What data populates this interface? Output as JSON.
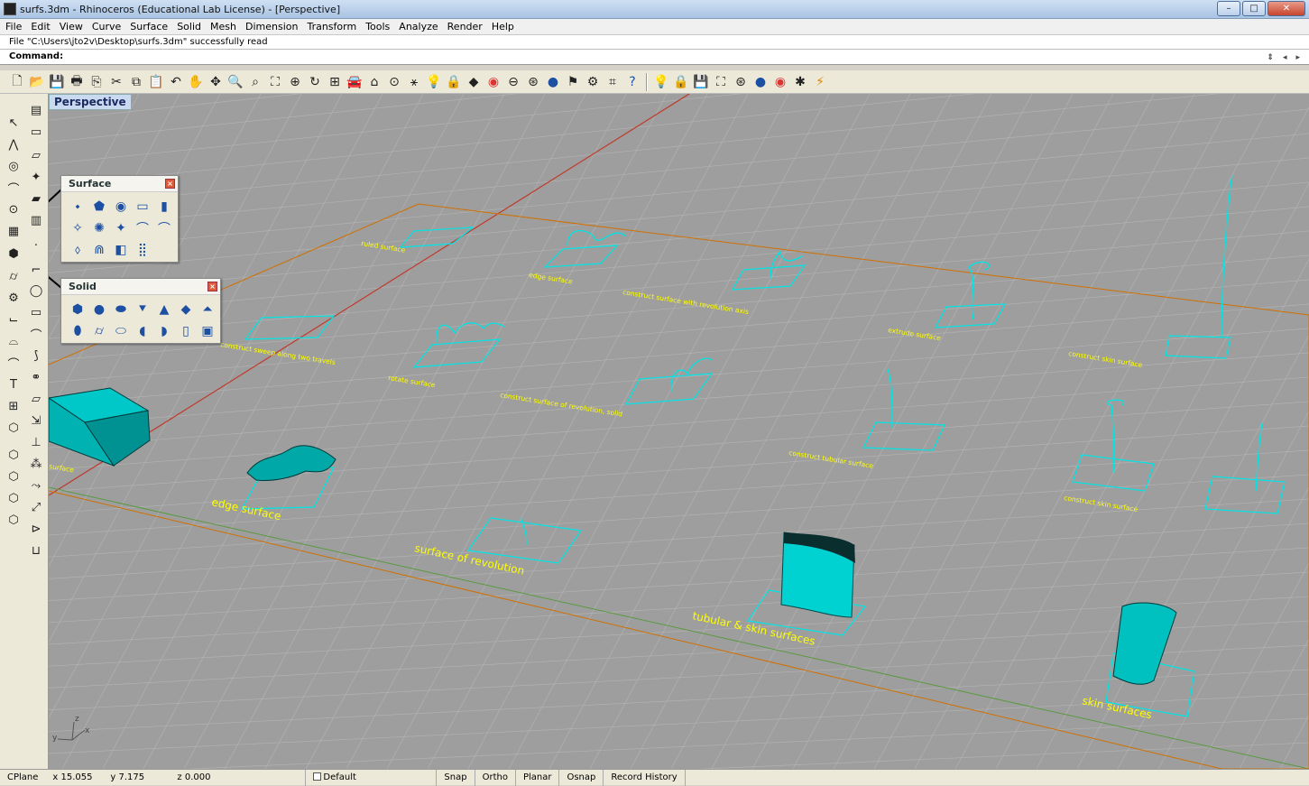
{
  "window": {
    "title": "surfs.3dm - Rhinoceros (Educational Lab License) - [Perspective]",
    "minimize": "–",
    "maximize": "□",
    "close": "✕"
  },
  "menu": [
    "File",
    "Edit",
    "View",
    "Curve",
    "Surface",
    "Solid",
    "Mesh",
    "Dimension",
    "Transform",
    "Tools",
    "Analyze",
    "Render",
    "Help"
  ],
  "history": {
    "text": "File \"C:\\Users\\jto2v\\Desktop\\surfs.3dm\" successfully read"
  },
  "command": {
    "label": "Command:",
    "value": ""
  },
  "viewport": {
    "label": "Perspective"
  },
  "surface_panel": {
    "title": "Surface",
    "icons": [
      "corner-points-icon",
      "edge-curves-icon",
      "planar-curves-icon",
      "rectangle-icon",
      "extrude-icon",
      "loft-icon",
      "revolve-icon",
      "rail-revolve-icon",
      "sweep1-icon",
      "sweep2-icon",
      "network-icon",
      "patch-icon",
      "point-grid-icon"
    ]
  },
  "solid_panel": {
    "title": "Solid",
    "icons": [
      "box-icon",
      "sphere-icon",
      "ellipsoid-icon",
      "paraboloid-icon",
      "cone-icon",
      "pyramid-icon",
      "truncated-cone-icon",
      "cylinder-icon",
      "tube-icon",
      "torus-icon",
      "pipe-icon",
      "extrude-solid-icon",
      "slab-icon",
      "text-solid-icon"
    ]
  },
  "scene_labels": [
    "ruled surface",
    "edge surface",
    "construct surface with revolution axis",
    "extrude surface",
    "construct skin surface",
    "construct sweep along two travels",
    "rotate surface",
    "construct surface of revolution, solid",
    "construct tubular surface",
    "construct skin surface",
    "edge surface",
    "surface of revolution",
    "tubular & skin surfaces",
    "skin surfaces",
    "surface"
  ],
  "axes": {
    "x": "x",
    "y": "y",
    "z": "z"
  },
  "status": {
    "cplane": "CPlane",
    "x": "x 15.055",
    "y": "y 7.175",
    "z": "z 0.000",
    "layer": "Default",
    "snap": "Snap",
    "ortho": "Ortho",
    "planar": "Planar",
    "osnap": "Osnap",
    "record": "Record History"
  },
  "colors": {
    "viewport_bg": "#9e9e9e",
    "object": "#00e5e5",
    "text": "#ffff00",
    "xaxis": "#c0392b",
    "grid_border": "#d07000"
  }
}
